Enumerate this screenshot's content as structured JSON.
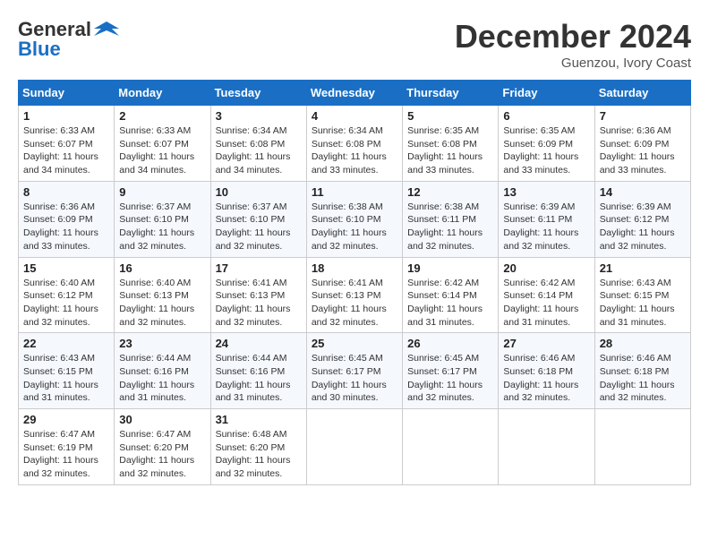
{
  "header": {
    "logo_general": "General",
    "logo_blue": "Blue",
    "month_title": "December 2024",
    "subtitle": "Guenzou, Ivory Coast"
  },
  "calendar": {
    "days_of_week": [
      "Sunday",
      "Monday",
      "Tuesday",
      "Wednesday",
      "Thursday",
      "Friday",
      "Saturday"
    ],
    "weeks": [
      [
        {
          "day": "1",
          "info": "Sunrise: 6:33 AM\nSunset: 6:07 PM\nDaylight: 11 hours and 34 minutes."
        },
        {
          "day": "2",
          "info": "Sunrise: 6:33 AM\nSunset: 6:07 PM\nDaylight: 11 hours and 34 minutes."
        },
        {
          "day": "3",
          "info": "Sunrise: 6:34 AM\nSunset: 6:08 PM\nDaylight: 11 hours and 34 minutes."
        },
        {
          "day": "4",
          "info": "Sunrise: 6:34 AM\nSunset: 6:08 PM\nDaylight: 11 hours and 33 minutes."
        },
        {
          "day": "5",
          "info": "Sunrise: 6:35 AM\nSunset: 6:08 PM\nDaylight: 11 hours and 33 minutes."
        },
        {
          "day": "6",
          "info": "Sunrise: 6:35 AM\nSunset: 6:09 PM\nDaylight: 11 hours and 33 minutes."
        },
        {
          "day": "7",
          "info": "Sunrise: 6:36 AM\nSunset: 6:09 PM\nDaylight: 11 hours and 33 minutes."
        }
      ],
      [
        {
          "day": "8",
          "info": "Sunrise: 6:36 AM\nSunset: 6:09 PM\nDaylight: 11 hours and 33 minutes."
        },
        {
          "day": "9",
          "info": "Sunrise: 6:37 AM\nSunset: 6:10 PM\nDaylight: 11 hours and 32 minutes."
        },
        {
          "day": "10",
          "info": "Sunrise: 6:37 AM\nSunset: 6:10 PM\nDaylight: 11 hours and 32 minutes."
        },
        {
          "day": "11",
          "info": "Sunrise: 6:38 AM\nSunset: 6:10 PM\nDaylight: 11 hours and 32 minutes."
        },
        {
          "day": "12",
          "info": "Sunrise: 6:38 AM\nSunset: 6:11 PM\nDaylight: 11 hours and 32 minutes."
        },
        {
          "day": "13",
          "info": "Sunrise: 6:39 AM\nSunset: 6:11 PM\nDaylight: 11 hours and 32 minutes."
        },
        {
          "day": "14",
          "info": "Sunrise: 6:39 AM\nSunset: 6:12 PM\nDaylight: 11 hours and 32 minutes."
        }
      ],
      [
        {
          "day": "15",
          "info": "Sunrise: 6:40 AM\nSunset: 6:12 PM\nDaylight: 11 hours and 32 minutes."
        },
        {
          "day": "16",
          "info": "Sunrise: 6:40 AM\nSunset: 6:13 PM\nDaylight: 11 hours and 32 minutes."
        },
        {
          "day": "17",
          "info": "Sunrise: 6:41 AM\nSunset: 6:13 PM\nDaylight: 11 hours and 32 minutes."
        },
        {
          "day": "18",
          "info": "Sunrise: 6:41 AM\nSunset: 6:13 PM\nDaylight: 11 hours and 32 minutes."
        },
        {
          "day": "19",
          "info": "Sunrise: 6:42 AM\nSunset: 6:14 PM\nDaylight: 11 hours and 31 minutes."
        },
        {
          "day": "20",
          "info": "Sunrise: 6:42 AM\nSunset: 6:14 PM\nDaylight: 11 hours and 31 minutes."
        },
        {
          "day": "21",
          "info": "Sunrise: 6:43 AM\nSunset: 6:15 PM\nDaylight: 11 hours and 31 minutes."
        }
      ],
      [
        {
          "day": "22",
          "info": "Sunrise: 6:43 AM\nSunset: 6:15 PM\nDaylight: 11 hours and 31 minutes."
        },
        {
          "day": "23",
          "info": "Sunrise: 6:44 AM\nSunset: 6:16 PM\nDaylight: 11 hours and 31 minutes."
        },
        {
          "day": "24",
          "info": "Sunrise: 6:44 AM\nSunset: 6:16 PM\nDaylight: 11 hours and 31 minutes."
        },
        {
          "day": "25",
          "info": "Sunrise: 6:45 AM\nSunset: 6:17 PM\nDaylight: 11 hours and 30 minutes."
        },
        {
          "day": "26",
          "info": "Sunrise: 6:45 AM\nSunset: 6:17 PM\nDaylight: 11 hours and 32 minutes."
        },
        {
          "day": "27",
          "info": "Sunrise: 6:46 AM\nSunset: 6:18 PM\nDaylight: 11 hours and 32 minutes."
        },
        {
          "day": "28",
          "info": "Sunrise: 6:46 AM\nSunset: 6:18 PM\nDaylight: 11 hours and 32 minutes."
        }
      ],
      [
        {
          "day": "29",
          "info": "Sunrise: 6:47 AM\nSunset: 6:19 PM\nDaylight: 11 hours and 32 minutes."
        },
        {
          "day": "30",
          "info": "Sunrise: 6:47 AM\nSunset: 6:20 PM\nDaylight: 11 hours and 32 minutes."
        },
        {
          "day": "31",
          "info": "Sunrise: 6:48 AM\nSunset: 6:20 PM\nDaylight: 11 hours and 32 minutes."
        },
        null,
        null,
        null,
        null
      ]
    ]
  }
}
